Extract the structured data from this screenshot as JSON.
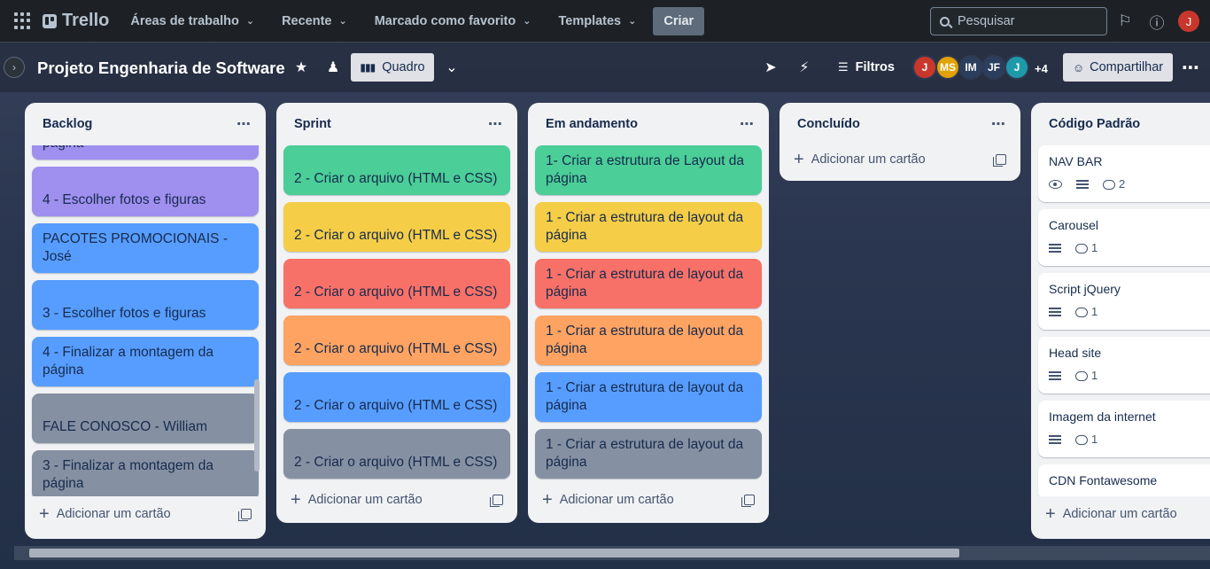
{
  "topnav": {
    "brand": "Trello",
    "menu": [
      {
        "label": "Áreas de trabalho"
      },
      {
        "label": "Recente"
      },
      {
        "label": "Marcado como favorito"
      },
      {
        "label": "Templates"
      }
    ],
    "create_label": "Criar",
    "search_placeholder": "Pesquisar",
    "user_initial": "J"
  },
  "board": {
    "title": "Projeto Engenharia de Software",
    "view_label": "Quadro",
    "filters_label": "Filtros",
    "members": [
      {
        "initials": "J",
        "color": "#c9372c"
      },
      {
        "initials": "MS",
        "color": "#e2b203"
      },
      {
        "initials": "IM",
        "color": "#2c3e5d"
      },
      {
        "initials": "JF",
        "color": "#2c3e5d"
      },
      {
        "initials": "J",
        "color": "#1d9aaa"
      }
    ],
    "more_members": "+4",
    "share_label": "Compartilhar"
  },
  "lists": [
    {
      "title": "Backlog",
      "cards": [
        {
          "text": "página",
          "color": "purple"
        },
        {
          "text": "4 - Escolher fotos e figuras",
          "color": "purple"
        },
        {
          "text": "PACOTES PROMOCIONAIS - José",
          "color": "blue"
        },
        {
          "text": "3 - Escolher fotos e figuras",
          "color": "blue"
        },
        {
          "text": "4 - Finalizar a montagem da página",
          "color": "blue"
        },
        {
          "text": "FALE CONOSCO - William",
          "color": "gray"
        },
        {
          "text": "3 - Finalizar a montagem da página",
          "color": "gray"
        }
      ],
      "add_label": "Adicionar um cartão"
    },
    {
      "title": "Sprint",
      "cards": [
        {
          "text": "2 - Criar o arquivo (HTML e CSS)",
          "color": "green"
        },
        {
          "text": "2 - Criar o arquivo (HTML e CSS)",
          "color": "yellow"
        },
        {
          "text": "2 - Criar o arquivo (HTML e CSS)",
          "color": "red"
        },
        {
          "text": "2 - Criar o arquivo (HTML e CSS)",
          "color": "orange"
        },
        {
          "text": "2 - Criar o arquivo (HTML e CSS)",
          "color": "blue"
        },
        {
          "text": "2 - Criar o arquivo (HTML e CSS)",
          "color": "gray"
        }
      ],
      "add_label": "Adicionar um cartão"
    },
    {
      "title": "Em andamento",
      "cards": [
        {
          "text": "1- Criar a estrutura de Layout da página",
          "color": "green"
        },
        {
          "text": "1 - Criar a estrutura de layout da página",
          "color": "yellow"
        },
        {
          "text": "1 - Criar a estrutura de layout da página",
          "color": "red"
        },
        {
          "text": "1 - Criar a estrutura de layout da página",
          "color": "orange"
        },
        {
          "text": "1 - Criar a estrutura de layout da página",
          "color": "blue"
        },
        {
          "text": "1 - Criar a estrutura de layout da página",
          "color": "gray"
        }
      ],
      "add_label": "Adicionar um cartão"
    },
    {
      "title": "Concluído",
      "cards": [],
      "add_label": "Adicionar um cartão"
    },
    {
      "title": "Código Padrão",
      "cards": [
        {
          "text": "NAV BAR",
          "watch": true,
          "description": true,
          "comments": "2"
        },
        {
          "text": "Carousel",
          "description": true,
          "comments": "1"
        },
        {
          "text": "Script jQuery",
          "description": true,
          "comments": "1"
        },
        {
          "text": "Head site",
          "description": true,
          "comments": "1"
        },
        {
          "text": "Imagem da internet",
          "description": true,
          "comments": "1"
        },
        {
          "text": "CDN Fontawesome"
        }
      ],
      "add_label": "Adicionar um cartão"
    }
  ]
}
